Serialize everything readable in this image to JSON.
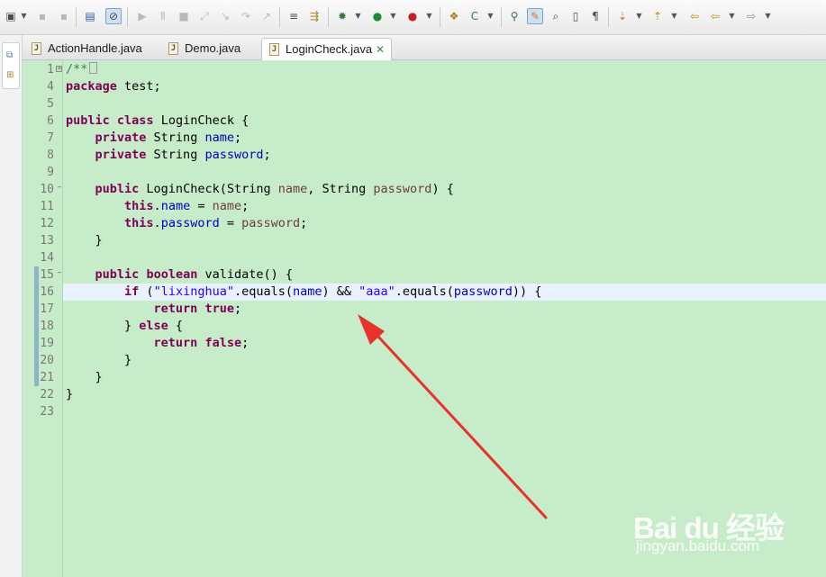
{
  "toolbar": {
    "icons": [
      "new-icon",
      "save-icon",
      "save-all-icon",
      "console-icon",
      "skip-breakpoints-icon",
      "resume-icon",
      "suspend-icon",
      "terminate-icon",
      "disconnect-icon",
      "step-into-icon",
      "step-over-icon",
      "step-return-icon",
      "drop-to-frame-icon",
      "use-step-filters-icon",
      "debug-icon",
      "run-icon",
      "run-last-icon",
      "new-java-project-icon",
      "new-class-icon",
      "open-type-icon",
      "search-icon",
      "mark-occurrences-icon",
      "toggle-block-selection-icon",
      "show-whitespace-icon",
      "next-annotation-icon",
      "previous-annotation-icon",
      "last-edit-location-icon",
      "back-icon",
      "forward-icon"
    ]
  },
  "trim": {
    "icons": [
      "restore-icon",
      "package-explorer-icon"
    ]
  },
  "tabs": [
    {
      "label": "ActionHandle.java",
      "active": false
    },
    {
      "label": "Demo.java",
      "active": false
    },
    {
      "label": "LoginCheck.java",
      "active": true
    }
  ],
  "editor": {
    "background": "#c6ecc9",
    "current_line": 16,
    "line_numbers": [
      "1",
      "4",
      "5",
      "6",
      "7",
      "8",
      "9",
      "10",
      "11",
      "12",
      "13",
      "14",
      "15",
      "16",
      "17",
      "18",
      "19",
      "20",
      "21",
      "22",
      "23"
    ],
    "lines": [
      {
        "num": "1",
        "text": "/**"
      },
      {
        "num": "4",
        "text": "package test;"
      },
      {
        "num": "5",
        "text": ""
      },
      {
        "num": "6",
        "text": "public class LoginCheck {"
      },
      {
        "num": "7",
        "text": "    private String name;"
      },
      {
        "num": "8",
        "text": "    private String password;"
      },
      {
        "num": "9",
        "text": ""
      },
      {
        "num": "10",
        "text": "    public LoginCheck(String name, String password) {"
      },
      {
        "num": "11",
        "text": "        this.name = name;"
      },
      {
        "num": "12",
        "text": "        this.password = password;"
      },
      {
        "num": "13",
        "text": "    }"
      },
      {
        "num": "14",
        "text": ""
      },
      {
        "num": "15",
        "text": "    public boolean validate() {"
      },
      {
        "num": "16",
        "text": "        if (\"lixinghua\".equals(name) && \"aaa\".equals(password)) {"
      },
      {
        "num": "17",
        "text": "            return true;"
      },
      {
        "num": "18",
        "text": "        } else {"
      },
      {
        "num": "19",
        "text": "            return false;"
      },
      {
        "num": "20",
        "text": "        }"
      },
      {
        "num": "21",
        "text": "    }"
      },
      {
        "num": "22",
        "text": "}"
      },
      {
        "num": "23",
        "text": ""
      }
    ]
  },
  "watermark": {
    "brand": "Bai du 经验",
    "url": "jingyan.baidu.com"
  },
  "annotation": {
    "color": "#e8322c"
  }
}
